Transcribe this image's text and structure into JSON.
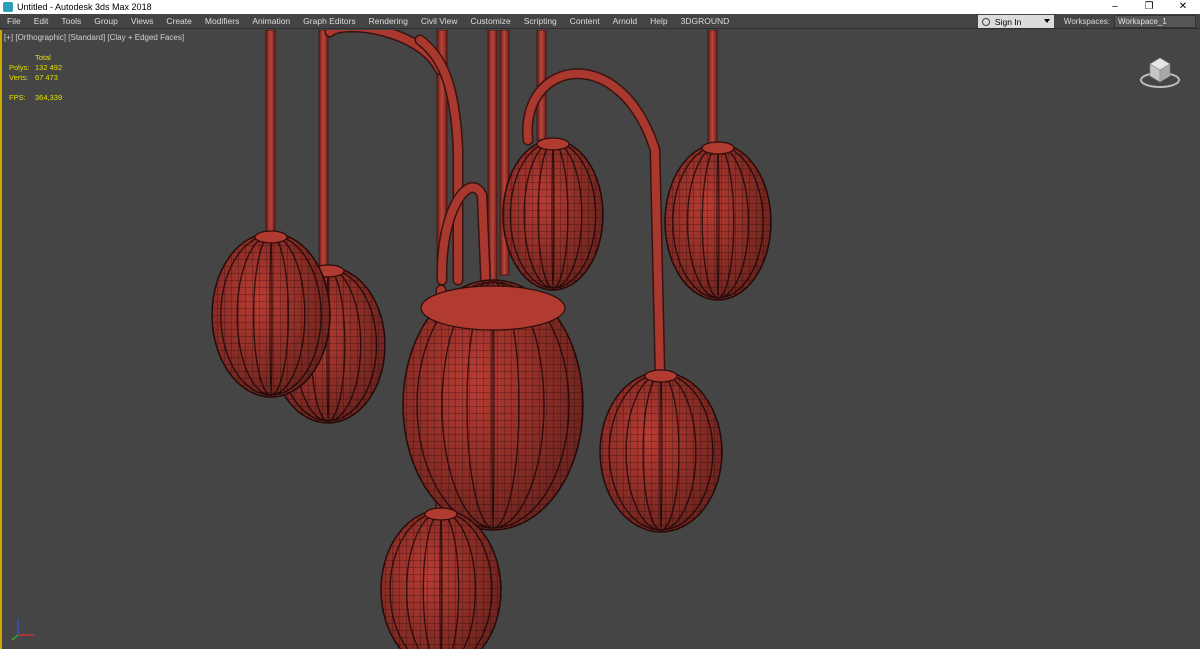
{
  "window": {
    "title": "Untitled - Autodesk 3ds Max 2018",
    "controls": {
      "minimize": "–",
      "restore": "❐",
      "close": "✕"
    }
  },
  "menu": {
    "items": [
      "File",
      "Edit",
      "Tools",
      "Group",
      "Views",
      "Create",
      "Modifiers",
      "Animation",
      "Graph Editors",
      "Rendering",
      "Civil View",
      "Customize",
      "Scripting",
      "Content",
      "Arnold",
      "Help",
      "3DGROUND"
    ],
    "sign_in": "Sign In",
    "workspaces_label": "Workspaces:",
    "workspace_value": "Workspace_1"
  },
  "viewport": {
    "label": "[+] [Orthographic] [Standard] [Clay + Edged Faces]",
    "stats": {
      "header": "Total",
      "polys_label": "Polys:",
      "polys_value": "132 492",
      "verts_label": "Verts:",
      "verts_value": "67 473",
      "fps_label": "FPS:",
      "fps_value": "364,339"
    }
  },
  "colors": {
    "viewport_bg": "#454545",
    "clay": "#b83c33",
    "wire": "#3a1210",
    "stats_text": "#e3e000",
    "active_border": "#c9a800"
  },
  "icons": [
    "3dsmax-app-icon",
    "user-icon",
    "chevron-down-icon",
    "viewcube-icon",
    "axis-tripod-icon"
  ]
}
